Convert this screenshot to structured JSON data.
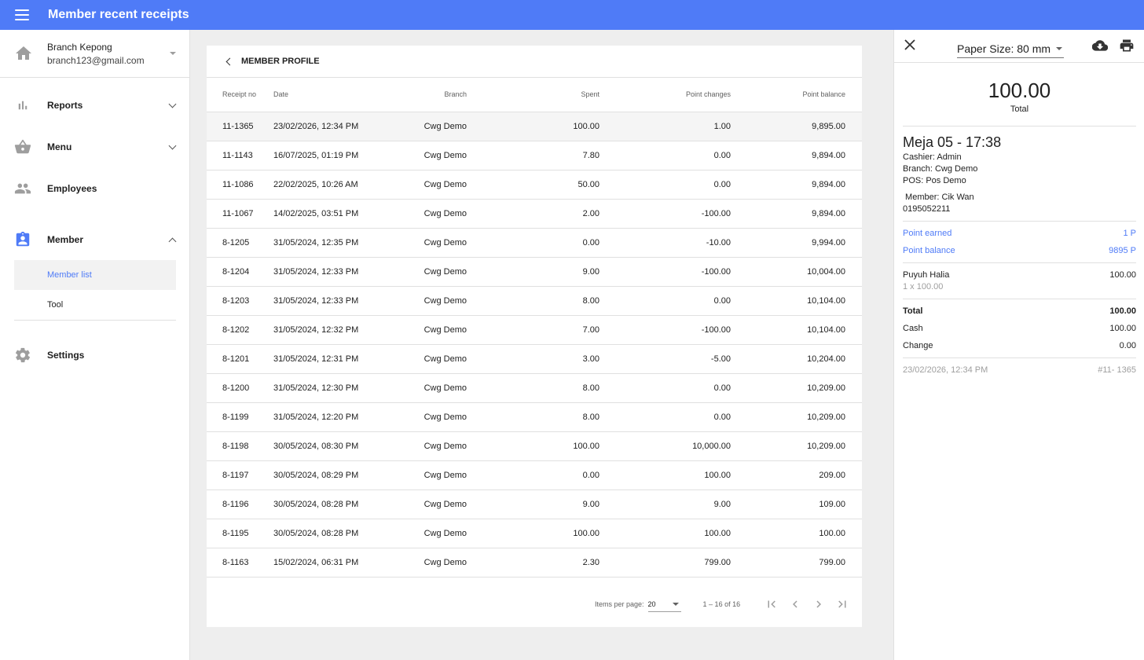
{
  "header": {
    "title": "Member recent receipts"
  },
  "account": {
    "name": "Branch Kepong",
    "email": "branch123@gmail.com"
  },
  "nav": {
    "reports": "Reports",
    "menu": "Menu",
    "employees": "Employees",
    "member": "Member",
    "member_list": "Member list",
    "tool": "Tool",
    "settings": "Settings"
  },
  "card": {
    "title": "MEMBER PROFILE",
    "columns": [
      "Receipt no",
      "Date",
      "Branch",
      "Spent",
      "Point changes",
      "Point balance"
    ],
    "rows": [
      [
        "11-1365",
        "23/02/2026, 12:34 PM",
        "Cwg Demo",
        "100.00",
        "1.00",
        "9,895.00"
      ],
      [
        "11-1143",
        "16/07/2025, 01:19 PM",
        "Cwg Demo",
        "7.80",
        "0.00",
        "9,894.00"
      ],
      [
        "11-1086",
        "22/02/2025, 10:26 AM",
        "Cwg Demo",
        "50.00",
        "0.00",
        "9,894.00"
      ],
      [
        "11-1067",
        "14/02/2025, 03:51 PM",
        "Cwg Demo",
        "2.00",
        "-100.00",
        "9,894.00"
      ],
      [
        "8-1205",
        "31/05/2024, 12:35 PM",
        "Cwg Demo",
        "0.00",
        "-10.00",
        "9,994.00"
      ],
      [
        "8-1204",
        "31/05/2024, 12:33 PM",
        "Cwg Demo",
        "9.00",
        "-100.00",
        "10,004.00"
      ],
      [
        "8-1203",
        "31/05/2024, 12:33 PM",
        "Cwg Demo",
        "8.00",
        "0.00",
        "10,104.00"
      ],
      [
        "8-1202",
        "31/05/2024, 12:32 PM",
        "Cwg Demo",
        "7.00",
        "-100.00",
        "10,104.00"
      ],
      [
        "8-1201",
        "31/05/2024, 12:31 PM",
        "Cwg Demo",
        "3.00",
        "-5.00",
        "10,204.00"
      ],
      [
        "8-1200",
        "31/05/2024, 12:30 PM",
        "Cwg Demo",
        "8.00",
        "0.00",
        "10,209.00"
      ],
      [
        "8-1199",
        "31/05/2024, 12:20 PM",
        "Cwg Demo",
        "8.00",
        "0.00",
        "10,209.00"
      ],
      [
        "8-1198",
        "30/05/2024, 08:30 PM",
        "Cwg Demo",
        "100.00",
        "10,000.00",
        "10,209.00"
      ],
      [
        "8-1197",
        "30/05/2024, 08:29 PM",
        "Cwg Demo",
        "0.00",
        "100.00",
        "209.00"
      ],
      [
        "8-1196",
        "30/05/2024, 08:28 PM",
        "Cwg Demo",
        "9.00",
        "9.00",
        "109.00"
      ],
      [
        "8-1195",
        "30/05/2024, 08:28 PM",
        "Cwg Demo",
        "100.00",
        "100.00",
        "100.00"
      ],
      [
        "8-1163",
        "15/02/2024, 06:31 PM",
        "Cwg Demo",
        "2.30",
        "799.00",
        "799.00"
      ]
    ],
    "selected_row": 0
  },
  "pagination": {
    "items_per_page_label": "Items per page:",
    "items_per_page": "20",
    "range": "1 – 16 of 16"
  },
  "receipt": {
    "paper_size": "Paper Size: 80 mm",
    "total_amount": "100.00",
    "total_label": "Total",
    "table_name": "Meja 05 - 17:38",
    "cashier": "Cashier: Admin",
    "branch": "Branch: Cwg Demo",
    "pos": "POS: Pos Demo",
    "member": " Member: Cik Wan",
    "phone": "0195052211",
    "point_earned_label": "Point earned",
    "point_earned_value": "1 P",
    "point_balance_label": "Point balance",
    "point_balance_value": "9895 P",
    "item_name": "Puyuh Halia",
    "item_amount": "100.00",
    "item_qty": "1 x 100.00",
    "total_row_label": "Total",
    "total_row_value": "100.00",
    "cash_label": "Cash",
    "cash_value": "100.00",
    "change_label": "Change",
    "change_value": "0.00",
    "footer_date": "23/02/2026, 12:34 PM",
    "footer_receipt": "#11- 1365"
  },
  "colors": {
    "primary": "#4f7bf7",
    "icon_gray": "#9e9e9e"
  },
  "icons": [
    "menu-icon",
    "home-icon",
    "bar-chart-icon",
    "basket-icon",
    "people-icon",
    "badge-icon",
    "gear-icon",
    "close-icon",
    "cloud-download-icon",
    "print-icon",
    "first-page-icon",
    "prev-page-icon",
    "next-page-icon",
    "last-page-icon"
  ]
}
